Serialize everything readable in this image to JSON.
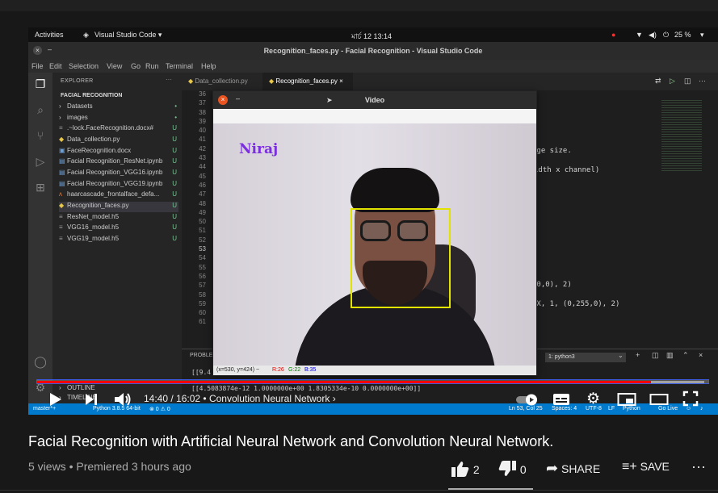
{
  "ubuntu": {
    "activities": "Activities",
    "app": "Visual Studio Code ▾",
    "clock": "মার্চ 12  13:14",
    "battery": "25 %"
  },
  "vscode": {
    "title": "Recognition_faces.py - Facial Recognition - Visual Studio Code",
    "menu": [
      "File",
      "Edit",
      "Selection",
      "View",
      "Go",
      "Run",
      "Terminal",
      "Help"
    ],
    "explorer_label": "EXPLORER",
    "project": "FACIAL RECOGNITION",
    "files": [
      {
        "name": "Datasets",
        "status": "•"
      },
      {
        "name": "images",
        "status": "•"
      },
      {
        "name": ".~lock.FaceRecognition.docx#",
        "status": "U"
      },
      {
        "name": "Data_collection.py",
        "status": "U"
      },
      {
        "name": "FaceRecognition.docx",
        "status": "U"
      },
      {
        "name": "Facial Recognition_ResNet.ipynb",
        "status": "U"
      },
      {
        "name": "Facial Recognition_VGG16.ipynb",
        "status": "U"
      },
      {
        "name": "Facial Recognition_VGG19.ipynb",
        "status": "U"
      },
      {
        "name": "haarcascade_frontalface_defa...",
        "status": "U"
      },
      {
        "name": "Recognition_faces.py",
        "status": "U"
      },
      {
        "name": "ResNet_model.h5",
        "status": "U"
      },
      {
        "name": "VGG16_model.h5",
        "status": "U"
      },
      {
        "name": "VGG19_model.h5",
        "status": "U"
      }
    ],
    "outline": "OUTLINE",
    "timeline": "TIMELINE",
    "tabs": [
      "Data_collection.py",
      "Recognition_faces.py"
    ],
    "line_numbers": [
      "36",
      "37",
      "38",
      "39",
      "40",
      "41",
      "42",
      "43",
      "44",
      "45",
      "46",
      "47",
      "48",
      "49",
      "50",
      "51",
      "52",
      "53",
      "54",
      "55",
      "56",
      "57",
      "58",
      "59",
      "60",
      "61"
    ],
    "code_right": [
      "age size.",
      "idth x channel)",
      ",0,0), 2)",
      "EX, 1, (0,255,0), 2)"
    ],
    "panel_tab": "PROBLE",
    "terminal_select": "1: python3",
    "terminal_lines": [
      "[[9.4",
      "[[4.5083874e-12 1.0000000e+00 1.8305334e-10 0.0000000e+00]]"
    ],
    "status": {
      "branch": "master*+",
      "python": "Python 3.8.5 64-bit",
      "errors": "⊗ 0 ⚠ 0",
      "position": "Ln 53, Col 25",
      "spaces": "Spaces: 4",
      "encoding": "UTF-8",
      "eol": "LF",
      "lang": "Python",
      "golive": "Go Live"
    }
  },
  "cv_window": {
    "title": "Video",
    "label": "Niraj",
    "coords": "(x=530, y=424) ~",
    "r": "R:26",
    "g": "G:22",
    "b": "B:35"
  },
  "player": {
    "progress_played": 0.915,
    "progress_buffered_end": 0.995,
    "current_time": "14:40",
    "duration": "16:02",
    "chapter": "Convolution Neural Network"
  },
  "video_info": {
    "title": "Facial Recognition with Artificial Neural Network and Convolution Neural Network.",
    "views": "5 views",
    "premiered": "Premiered 3 hours ago",
    "likes": "2",
    "dislikes": "0",
    "share": "SHARE",
    "save": "SAVE"
  }
}
